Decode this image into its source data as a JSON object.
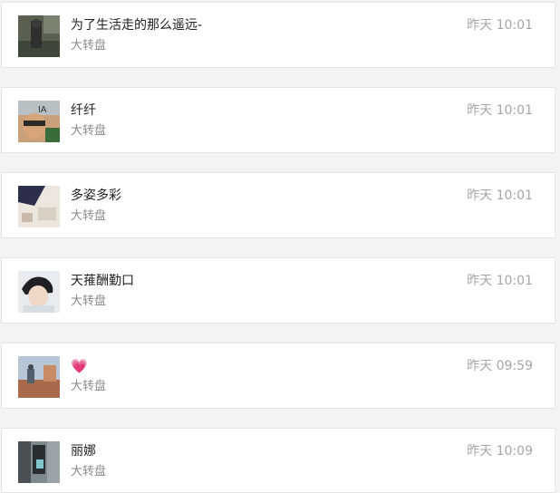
{
  "messages": [
    {
      "name": "为了生活走的那么遥远-",
      "subtitle": "大转盘",
      "time": "昨天 10:01"
    },
    {
      "name": "纤纤",
      "subtitle": "大转盘",
      "time": "昨天 10:01"
    },
    {
      "name": "多姿多彩",
      "subtitle": "大转盘",
      "time": "昨天 10:01"
    },
    {
      "name": "天蓷酬勤口",
      "subtitle": "大转盘",
      "time": "昨天 10:01"
    },
    {
      "name": "💗",
      "subtitle": "大转盘",
      "time": "昨天 09:59"
    },
    {
      "name": "丽娜",
      "subtitle": "大转盘",
      "time": "昨天 10:09"
    }
  ]
}
